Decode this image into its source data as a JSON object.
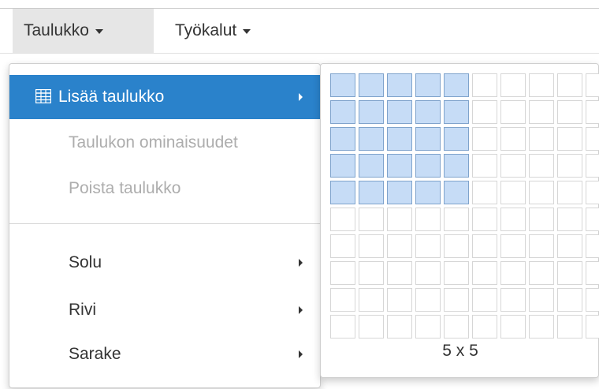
{
  "menubar": {
    "items": [
      {
        "label": "Taulukko",
        "active": true
      },
      {
        "label": "Työkalut",
        "active": false
      }
    ]
  },
  "table_menu": {
    "items": [
      {
        "label": "Lisää taulukko",
        "icon": "table-icon",
        "state": "highlighted",
        "submenu": true
      },
      {
        "label": "Taulukon ominaisuudet",
        "state": "disabled",
        "submenu": false
      },
      {
        "label": "Poista taulukko",
        "state": "disabled",
        "submenu": false
      },
      {
        "label": "Solu",
        "state": "normal",
        "submenu": true
      },
      {
        "label": "Rivi",
        "state": "normal",
        "submenu": true
      },
      {
        "label": "Sarake",
        "state": "normal",
        "submenu": true
      }
    ]
  },
  "table_picker": {
    "grid_columns": 10,
    "grid_rows": 10,
    "selected_columns": 5,
    "selected_rows": 5,
    "size_label": "5 x 5",
    "colors": {
      "selected_fill": "#c6dcf6",
      "selected_border": "#7fa3cc",
      "cell_border": "#d6d6d6"
    }
  },
  "colors": {
    "highlight": "#2a82cb",
    "disabled_text": "#adadad",
    "active_menubar_bg": "#e6e6e6"
  }
}
